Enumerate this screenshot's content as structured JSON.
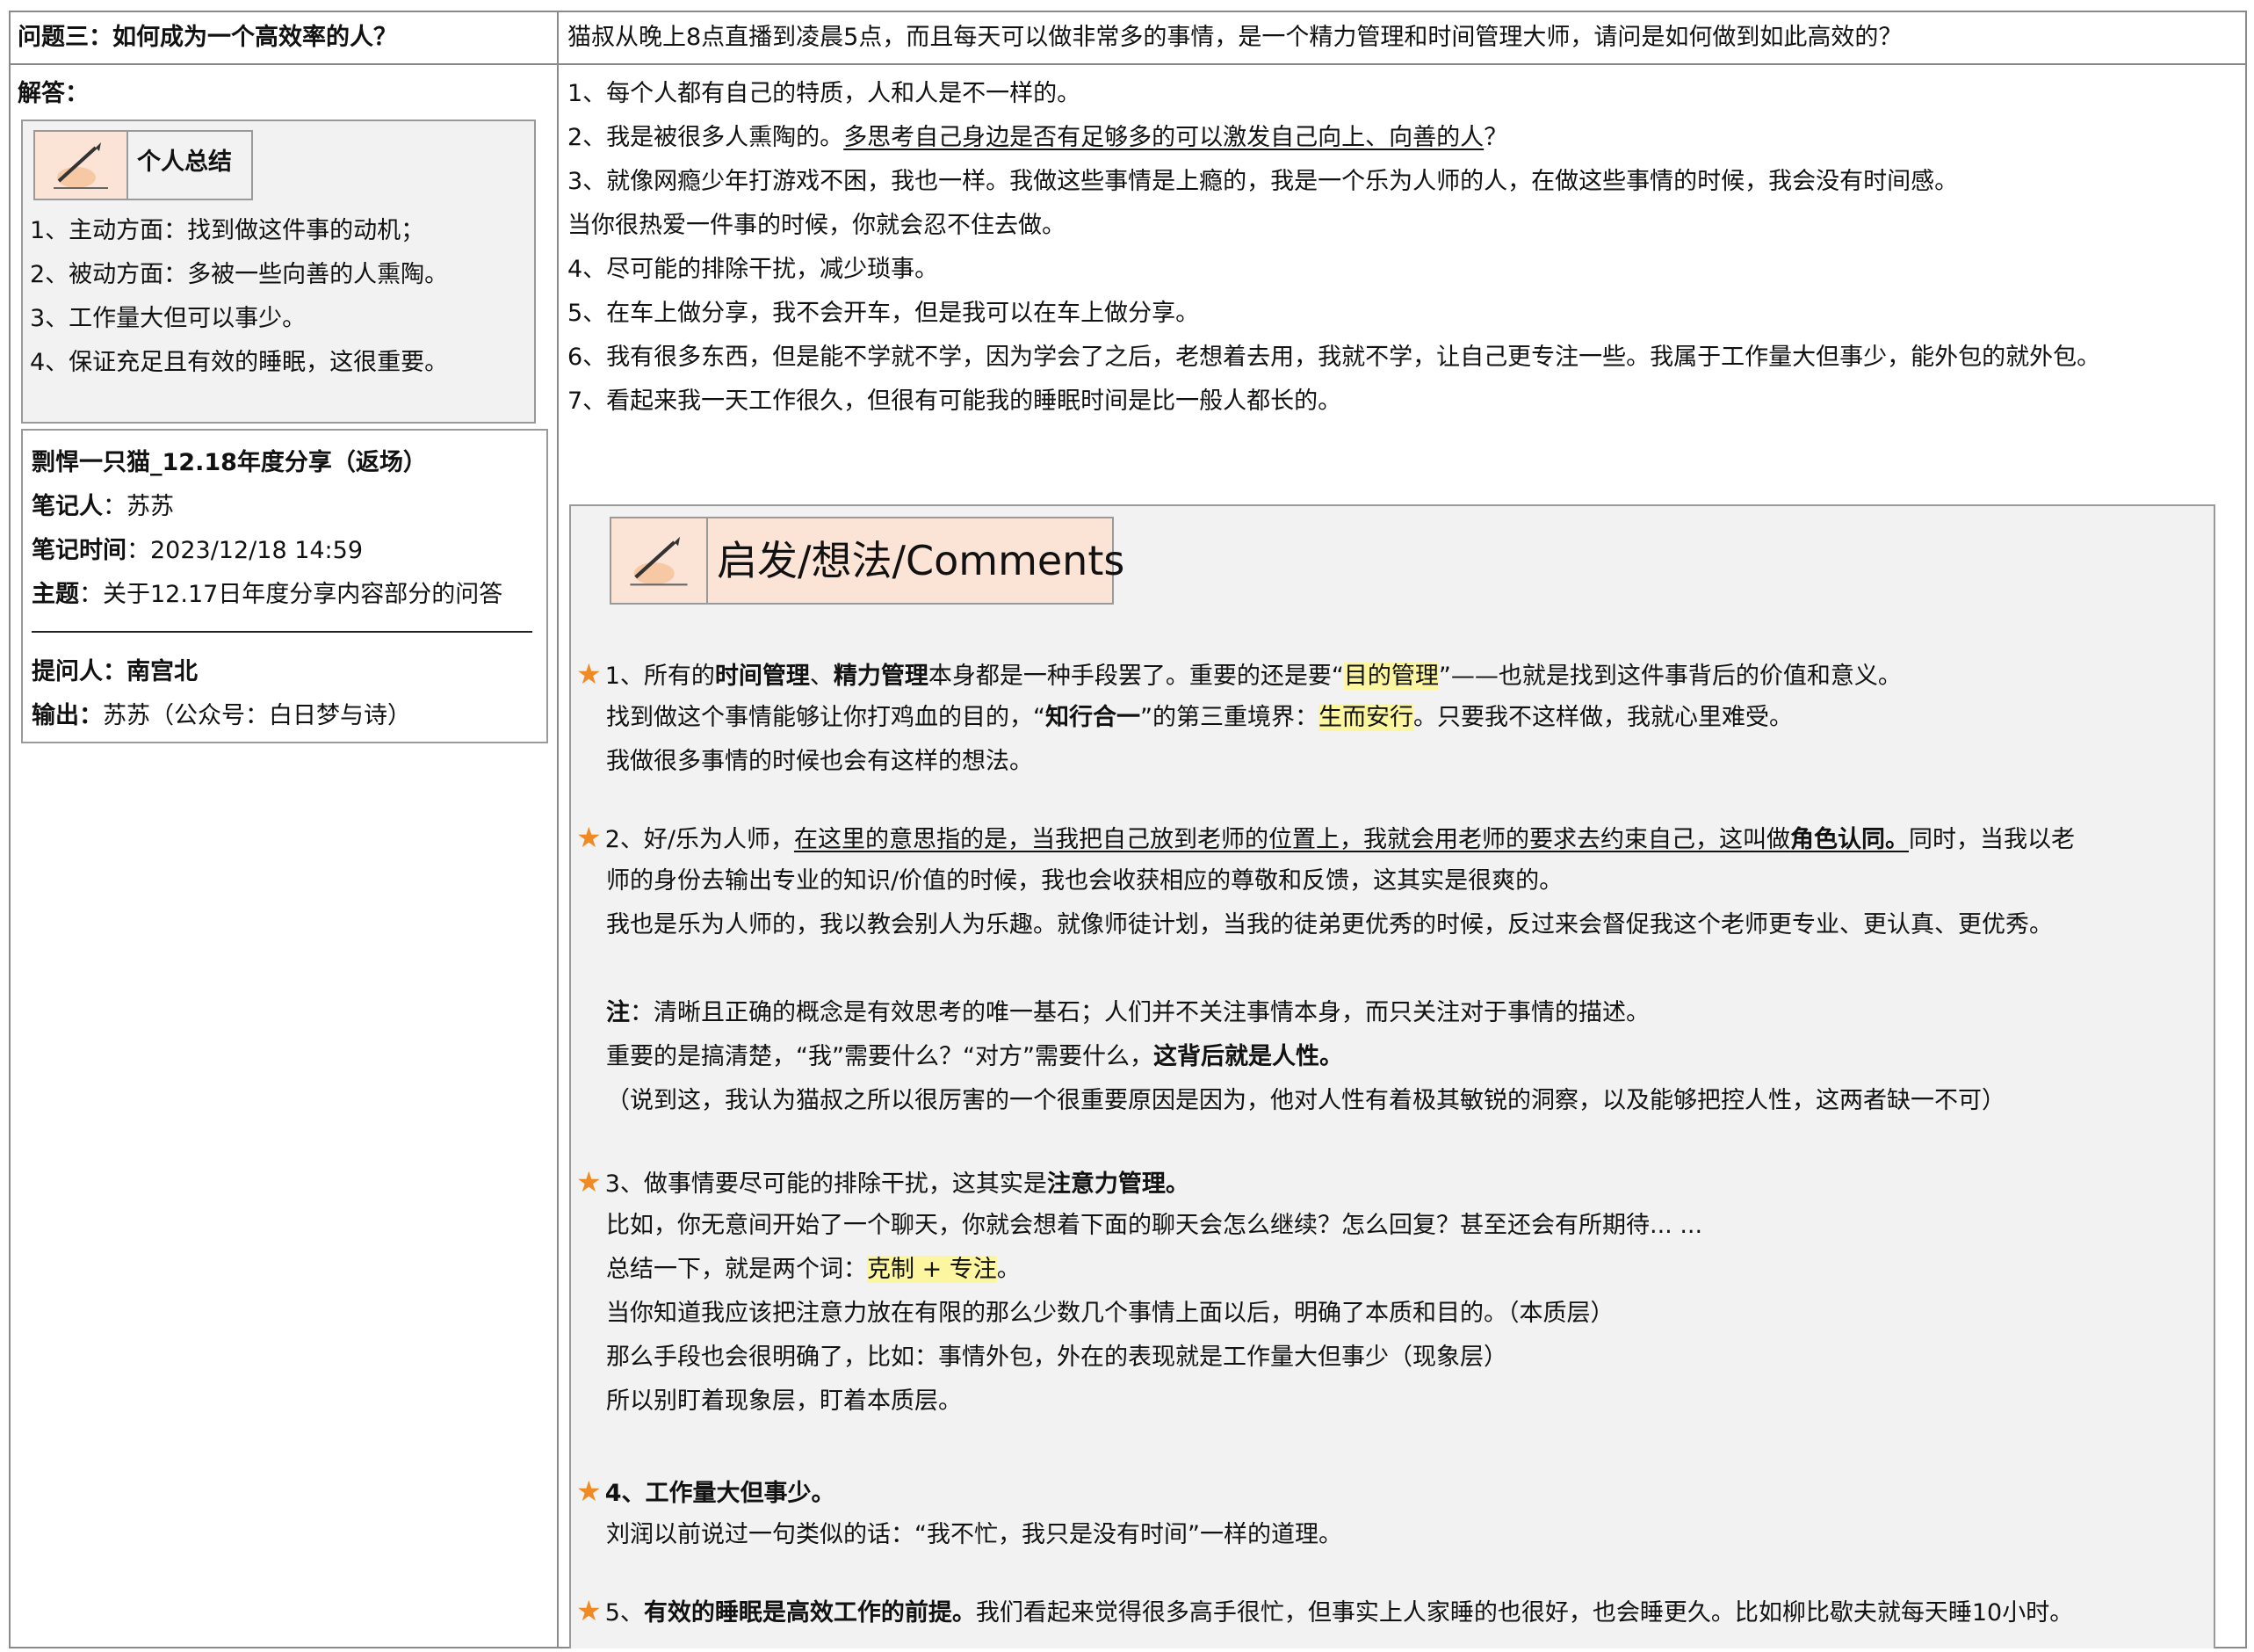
{
  "header": {
    "question": "问题三：如何成为一个高效率的人？",
    "question_text": "猫叔从晚上8点直播到凌晨5点，而且每天可以做非常多的事情，是一个精力管理和时间管理大师，请问是如何做到如此高效的？"
  },
  "answer_label": "解答：",
  "summary": {
    "title": "个人总结",
    "items": [
      "1、主动方面：找到做这件事的动机；",
      "2、被动方面：多被一些向善的人熏陶。",
      "3、工作量大但可以事少。",
      "4、保证充足且有效的睡眠，这很重要。"
    ]
  },
  "note_meta": {
    "title": "剽悍一只猫_12.18年度分享（返场）",
    "recorder_label": "笔记人",
    "recorder": "：苏苏",
    "time_label": "笔记时间",
    "time": "：2023/12/18 14:59",
    "topic_label": "主题",
    "topic": "：关于12.17日年度分享内容部分的问答",
    "asker": "提问人：南宫北",
    "output_label": "输出：",
    "output": "苏苏（公众号：白日梦与诗）"
  },
  "answers": {
    "l1": "1、每个人都有自己的特质，人和人是不一样的。",
    "l2a": "2、我是被很多人熏陶的。",
    "l2b": "多思考自己身边是否有足够多的可以激发自己向上、向善的人",
    "l2c": "？",
    "l3": "3、就像网瘾少年打游戏不困，我也一样。我做这些事情是上瘾的，我是一个乐为人师的人，在做这些事情的时候，我会没有时间感。",
    "l3b": "当你很热爱一件事的时候，你就会忍不住去做。",
    "l4": "4、尽可能的排除干扰，减少琐事。",
    "l5": "5、在车上做分享，我不会开车，但是我可以在车上做分享。",
    "l6": "6、我有很多东西，但是能不学就不学，因为学会了之后，老想着去用，我就不学，让自己更专注一些。我属于工作量大但事少，能外包的就外包。",
    "l7": "7、看起来我一天工作很久，但很有可能我的睡眠时间是比一般人都长的。"
  },
  "comments": {
    "title": "启发/想法/Comments",
    "c1": {
      "a": "1、所有的",
      "b": "时间管理",
      "c": "、",
      "d": "精力管理",
      "e": "本身都是一种手段罢了。重要的还是要“",
      "f": "目的管理",
      "g": "”——也就是找到这件事背后的价值和意义。",
      "l2a": "找到做这个事情能够让你打鸡血的目的，“",
      "l2b": "知行合一",
      "l2c": "”的第三重境界：",
      "l2d": "生而安行",
      "l2e": "。只要我不这样做，我就心里难受。",
      "l3": "我做很多事情的时候也会有这样的想法。"
    },
    "c2": {
      "a": "2、好/乐为人师，",
      "b": "在这里的意思指的是，当我把自己放到老师的位置上，我就会用老师的要求去约束自己，这叫做",
      "c": "角色认同。",
      "d": "同时，当我以老",
      "l2": "师的身份去输出专业的知识/价值的时候，我也会收获相应的尊敬和反馈，这其实是很爽的。",
      "l3": "我也是乐为人师的，我以教会别人为乐趣。就像师徒计划，当我的徒弟更优秀的时候，反过来会督促我这个老师更专业、更认真、更优秀。",
      "n1a": "注",
      "n1b": "：清晰且正确的概念是有效思考的唯一基石；人们并不关注事情本身，而只关注对于事情的描述。",
      "n2a": "重要的是搞清楚，“我”需要什么？“对方”需要什么，",
      "n2b": "这背后就是人性。",
      "n3": "（说到这，我认为猫叔之所以很厉害的一个很重要原因是因为，他对人性有着极其敏锐的洞察，以及能够把控人性，这两者缺一不可）"
    },
    "c3": {
      "a": "3、做事情要尽可能的排除干扰，这其实是",
      "b": "注意力管理。",
      "l2": "比如，你无意间开始了一个聊天，你就会想着下面的聊天会怎么继续？怎么回复？甚至还会有所期待... ...",
      "l3a": "总结一下，就是两个词：",
      "l3b": "克制 + 专注",
      "l3c": "。",
      "l4": "当你知道我应该把注意力放在有限的那么少数几个事情上面以后，明确了本质和目的。（本质层）",
      "l5": "那么手段也会很明确了，比如：事情外包，外在的表现就是工作量大但事少（现象层）",
      "l6": "所以别盯着现象层，盯着本质层。"
    },
    "c4": {
      "a": "4、工作量大但事少。",
      "l2": "刘润以前说过一句类似的话：“我不忙，我只是没有时间”一样的道理。"
    },
    "c5": {
      "a": "5、",
      "b": "有效的睡眠是高效工作的前提。",
      "c": "我们看起来觉得很多高手很忙，但事实上人家睡的也很好，也会睡更久。比如柳比歇夫就每天睡10小时。"
    }
  },
  "colors": {
    "star": "#f08a24",
    "highlight": "#fdf6a0",
    "pencil_bg": "#fbe3d6",
    "panel_bg": "#f2f2f2"
  }
}
